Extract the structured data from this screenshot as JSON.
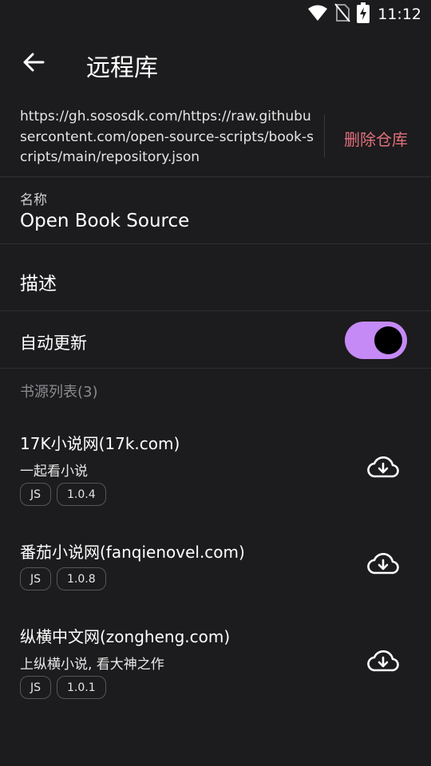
{
  "status": {
    "time": "11:12",
    "icons": [
      "wifi-icon",
      "no-sim-icon",
      "battery-charging-icon"
    ]
  },
  "appbar": {
    "title": "远程库",
    "back_icon": "arrow-left-icon"
  },
  "repository": {
    "url": "https://gh.sososdk.com/https://raw.githubusercontent.com/open-source-scripts/book-scripts/main/repository.json",
    "delete_label": "删除仓库"
  },
  "name": {
    "label": "名称",
    "value": "Open Book Source"
  },
  "description": {
    "label": "描述"
  },
  "auto_update": {
    "label": "自动更新",
    "enabled": true
  },
  "sources": {
    "title": "书源列表(3)",
    "items": [
      {
        "title": "17K小说网(17k.com)",
        "subtitle": "一起看小说",
        "tags": [
          "JS",
          "1.0.4"
        ]
      },
      {
        "title": "番茄小说网(fanqienovel.com)",
        "subtitle": "",
        "tags": [
          "JS",
          "1.0.8"
        ]
      },
      {
        "title": "纵横中文网(zongheng.com)",
        "subtitle": "上纵横小说, 看大神之作",
        "tags": [
          "JS",
          "1.0.1"
        ]
      }
    ]
  },
  "colors": {
    "background": "#1c1b1d",
    "accent": "#c58af5",
    "danger": "#e0707c"
  }
}
